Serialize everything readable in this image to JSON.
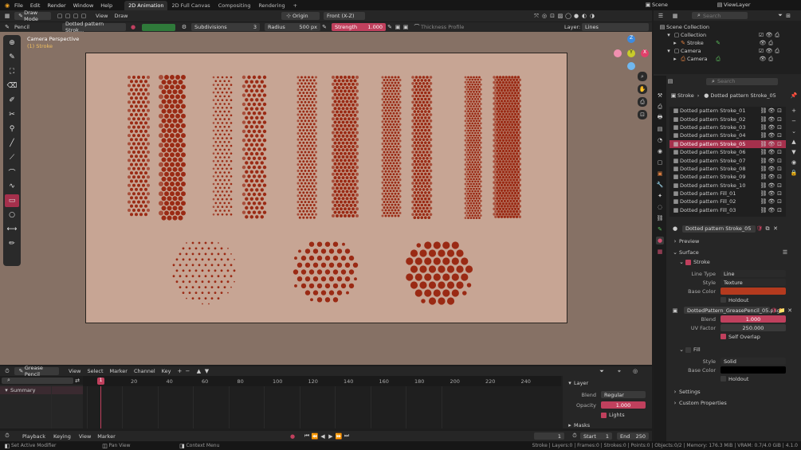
{
  "topbar": {
    "menu": [
      "File",
      "Edit",
      "Render",
      "Window",
      "Help"
    ],
    "workspaces": [
      "2D Animation",
      "2D Full Canvas",
      "Compositing",
      "Rendering"
    ],
    "add_tab": "+",
    "scene": "Scene",
    "view_layer": "ViewLayer"
  },
  "header": {
    "mode": "Draw Mode",
    "view": "View",
    "draw": "Draw",
    "origin": "Origin",
    "front": "Front (X-Z)"
  },
  "tool_header": {
    "tool": "Pencil",
    "material": "Dotted pattern Strok...",
    "subdivisions_label": "Subdivisions",
    "subdivisions_value": "3",
    "radius_label": "Radius",
    "radius_value": "500 px",
    "strength_label": "Strength",
    "strength_value": "1.000",
    "thickness_profile": "Thickness Profile",
    "layer_label": "Layer:",
    "layer_value": "Lines"
  },
  "viewport": {
    "camera_label": "Camera Perspective",
    "object_label": "(1) Stroke",
    "color_bg": "#867165",
    "color_canvas": "#c7a594",
    "dot_color": "#9a2a14"
  },
  "outliner": {
    "search_placeholder": "Search",
    "items": [
      "Scene Collection",
      "Collection",
      "Stroke",
      "Camera",
      "Camera"
    ]
  },
  "properties": {
    "search_placeholder": "Search",
    "breadcrumb_object": "Stroke",
    "breadcrumb_material": "Dotted pattern Stroke_05",
    "materials": [
      "Dotted pattern Stroke_01",
      "Dotted pattern Stroke_02",
      "Dotted pattern Stroke_03",
      "Dotted pattern Stroke_04",
      "Dotted pattern Stroke_05",
      "Dotted pattern Stroke_06",
      "Dotted pattern Stroke_07",
      "Dotted pattern Stroke_08",
      "Dotted pattern Stroke_09",
      "Dotted pattern Stroke_10",
      "Dotted pattern Fill_01",
      "Dotted pattern Fill_02",
      "Dotted pattern Fill_03"
    ],
    "selected_material_index": 4,
    "material_name": "Dotted pattern Stroke_05",
    "preview": "Preview",
    "surface": "Surface",
    "stroke": "Stroke",
    "line_type_label": "Line Type",
    "line_type_value": "Line",
    "style_label": "Style",
    "style_value": "Texture",
    "base_color_label": "Base Color",
    "stroke_color": "#b43a1e",
    "holdout": "Holdout",
    "texture_name": "DottedPattern_GreasePencil_05.png",
    "blend_label": "Blend",
    "blend_value": "1.000",
    "uv_factor_label": "UV Factor",
    "uv_factor_value": "250.000",
    "self_overlap": "Self Overlap",
    "fill": "Fill",
    "fill_style_label": "Style",
    "fill_style_value": "Solid",
    "fill_base_color_label": "Base Color",
    "fill_color": "#000000",
    "fill_holdout": "Holdout",
    "settings": "Settings",
    "custom_properties": "Custom Properties"
  },
  "timeline": {
    "editor": "Grease Pencil",
    "menu": [
      "View",
      "Select",
      "Marker",
      "Channel",
      "Key"
    ],
    "search_placeholder": "",
    "summary": "Summary",
    "current_frame": "1",
    "ticks": [
      "20",
      "40",
      "60",
      "80",
      "100",
      "120",
      "140",
      "160",
      "180",
      "200",
      "220",
      "240"
    ],
    "layer_panel": "Layer",
    "blend_label": "Blend",
    "blend_value": "Regular",
    "opacity_label": "Opacity",
    "opacity_value": "1.000",
    "lights": "Lights",
    "masks": "Masks"
  },
  "footer": {
    "menu": [
      "Playback",
      "Keying",
      "View",
      "Marker"
    ],
    "frame": "1",
    "start_label": "Start",
    "start_value": "1",
    "end_label": "End",
    "end_value": "250"
  },
  "statusbar": {
    "left": "Set Active Modifier",
    "mid": "Pan View",
    "ctx": "Context Menu",
    "stats": "Stroke | Layers:0 | Frames:0 | Strokes:0 | Points:0 | Objects:0/2 | Memory: 176.3 MiB | VRAM: 0.7/4.0 GiB | 4.1.0"
  }
}
